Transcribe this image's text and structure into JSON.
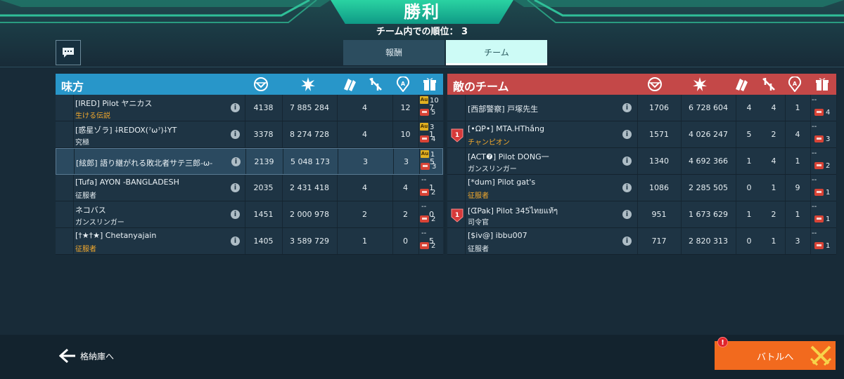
{
  "header": {
    "title": "勝利",
    "rank_label": "チーム内での順位：",
    "rank_value": "3"
  },
  "tabs": [
    {
      "label": "報酬",
      "selected": false
    },
    {
      "label": "チーム",
      "selected": true
    }
  ],
  "ally": {
    "title": "味方",
    "color": "#2896c9",
    "players": [
      {
        "name": "[IRED] Pilot ヤニカス",
        "title": "生ける伝説",
        "title_color": "gold",
        "c1": "4138",
        "c2": "7 885 284",
        "c3": "4",
        "c4": "12",
        "c5": "7",
        "reward_top": "10",
        "reward_bottom": "5",
        "top_type": "au"
      },
      {
        "name": "[惑星ゾラ] ⸸REDOX(ˀωˀ)⸸YT",
        "title": "究極",
        "title_color": "white",
        "c1": "3378",
        "c2": "8 274 728",
        "c3": "4",
        "c4": "10",
        "c5": "1",
        "reward_top": "3",
        "reward_bottom": "4",
        "top_type": "au"
      },
      {
        "name": "[絃郎] 語り継がれる敗北者サテ三郎-ω-",
        "title": "",
        "title_color": "white",
        "c1": "2139",
        "c2": "5 048 173",
        "c3": "3",
        "c4": "3",
        "c5": "5",
        "reward_top": "1",
        "reward_bottom": "3",
        "top_type": "au",
        "me": true
      },
      {
        "name": "[Tufa] AYON -BANGLADESH",
        "title": "征服者",
        "title_color": "white",
        "c1": "2035",
        "c2": "2 431 418",
        "c3": "4",
        "c4": "4",
        "c5": "1",
        "reward_top": "--",
        "reward_bottom": "2",
        "top_type": "dash"
      },
      {
        "name": "ネコバス",
        "title": "ガンスリンガー",
        "title_color": "white",
        "c1": "1451",
        "c2": "2 000 978",
        "c3": "2",
        "c4": "2",
        "c5": "0",
        "reward_top": "--",
        "reward_bottom": "2",
        "top_type": "dash"
      },
      {
        "name": "[†★†★] Chetanyajain",
        "title": "征服者",
        "title_color": "gold",
        "c1": "1405",
        "c2": "3 589 729",
        "c3": "1",
        "c4": "0",
        "c5": "5",
        "reward_top": "--",
        "reward_bottom": "2",
        "top_type": "dash"
      }
    ]
  },
  "enemy": {
    "title": "敵のチーム",
    "color": "#c44848",
    "players": [
      {
        "name": "[西部警察] 戸塚先生",
        "title": "",
        "title_color": "white",
        "c1": "1706",
        "c2": "6 728 604",
        "c3": "4",
        "c4": "4",
        "c5": "1",
        "reward_top": "--",
        "reward_bottom": "4",
        "leader": false
      },
      {
        "name": "[•ΩP•] MTA.HThắng",
        "title": "チャンピオン",
        "title_color": "gold",
        "c1": "1571",
        "c2": "4 026 247",
        "c3": "5",
        "c4": "2",
        "c5": "4",
        "reward_top": "--",
        "reward_bottom": "3",
        "leader": true
      },
      {
        "name": "[ACT❼] Pilot DONG一",
        "title": "ガンスリンガー",
        "title_color": "white",
        "c1": "1340",
        "c2": "4 692 366",
        "c3": "1",
        "c4": "4",
        "c5": "1",
        "reward_top": "--",
        "reward_bottom": "2",
        "leader": false
      },
      {
        "name": "[*dum] Pilot gat's",
        "title": "征服者",
        "title_color": "gold",
        "c1": "1086",
        "c2": "2 285 505",
        "c3": "0",
        "c4": "1",
        "c5": "9",
        "reward_top": "--",
        "reward_bottom": "1",
        "leader": false
      },
      {
        "name": "[ᗧPak] Pilot 345ไทยแท้ๆ",
        "title": "司令官",
        "title_color": "white",
        "c1": "951",
        "c2": "1 673 629",
        "c3": "1",
        "c4": "2",
        "c5": "1",
        "reward_top": "--",
        "reward_bottom": "1",
        "leader": true
      },
      {
        "name": "[$iv@] ibbu007",
        "title": "征服者",
        "title_color": "white",
        "c1": "717",
        "c2": "2 820 313",
        "c3": "0",
        "c4": "1",
        "c5": "3",
        "reward_top": "--",
        "reward_bottom": "1",
        "leader": false
      }
    ]
  },
  "column_icons": [
    "rating-icon",
    "damage-icon",
    "kills-icon",
    "assists-icon",
    "capture-icon",
    "gift-icon"
  ],
  "footer": {
    "back_label": "格納庫へ",
    "battle_label": "バトルへ",
    "alert_badge": "!"
  },
  "colors": {
    "accent_green": "#2ad3a2",
    "battle_orange": "#f26a1e",
    "gold_text": "#f3a92c"
  }
}
